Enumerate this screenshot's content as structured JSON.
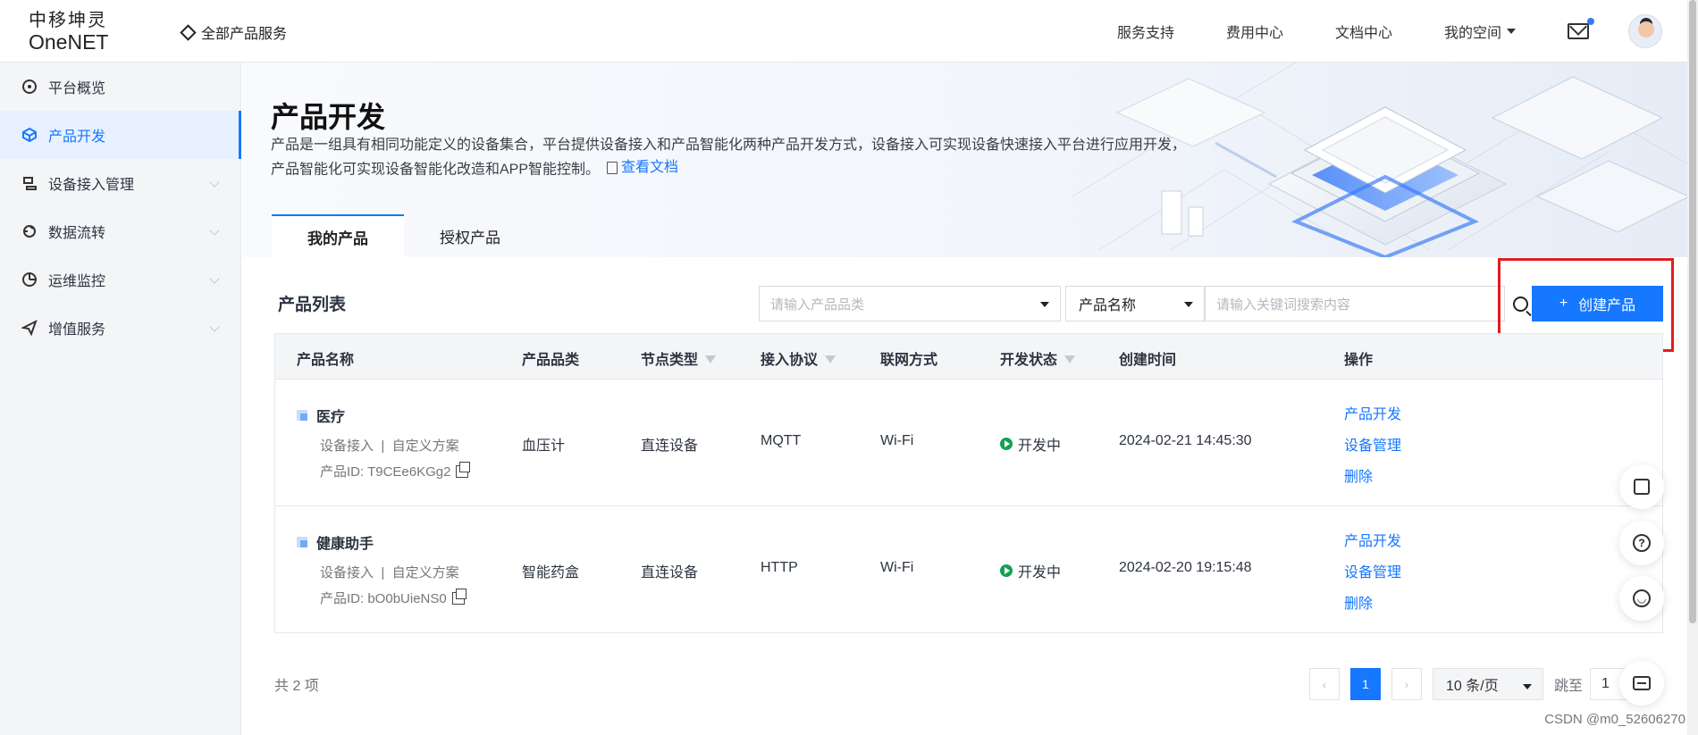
{
  "brand": {
    "line1": "中移坤灵",
    "line2": "OneNET"
  },
  "header": {
    "all_products": "全部产品服务",
    "links": [
      "服务支持",
      "费用中心",
      "文档中心"
    ],
    "my_space": "我的空间"
  },
  "sidebar": {
    "items": [
      {
        "label": "平台概览",
        "icon": "overview-icon"
      },
      {
        "label": "产品开发",
        "icon": "cube-icon"
      },
      {
        "label": "设备接入管理",
        "icon": "device-icon"
      },
      {
        "label": "数据流转",
        "icon": "data-flow-icon"
      },
      {
        "label": "运维监控",
        "icon": "monitor-icon"
      },
      {
        "label": "增值服务",
        "icon": "send-icon"
      }
    ]
  },
  "page": {
    "title": "产品开发",
    "description_line1": "产品是一组具有相同功能定义的设备集合，平台提供设备接入和产品智能化两种产品开发方式，设备接入可实现设备快速接入平台进行应用开发，",
    "description_line2": "产品智能化可实现设备智能化改造和APP智能控制。",
    "doc_link": "查看文档",
    "tabs": [
      "我的产品",
      "授权产品"
    ]
  },
  "toolbar": {
    "section_title": "产品列表",
    "category_placeholder": "请输入产品品类",
    "search_field_label": "产品名称",
    "search_placeholder": "请输入关键词搜索内容",
    "create_button": "创建产品"
  },
  "table": {
    "columns": [
      "产品名称",
      "产品品类",
      "节点类型",
      "接入协议",
      "联网方式",
      "开发状态",
      "创建时间",
      "操作"
    ],
    "rows": [
      {
        "name": "医疗",
        "access": "设备接入",
        "plan": "自定义方案",
        "product_id_label": "产品ID:",
        "product_id": "T9CEe6KGg2",
        "category": "血压计",
        "node_type": "直连设备",
        "protocol": "MQTT",
        "network": "Wi-Fi",
        "status": "开发中",
        "created": "2024-02-21 14:45:30",
        "actions": [
          "产品开发",
          "设备管理",
          "删除"
        ]
      },
      {
        "name": "健康助手",
        "access": "设备接入",
        "plan": "自定义方案",
        "product_id_label": "产品ID:",
        "product_id": "bO0bUieNS0",
        "category": "智能药盒",
        "node_type": "直连设备",
        "protocol": "HTTP",
        "network": "Wi-Fi",
        "status": "开发中",
        "created": "2024-02-20 19:15:48",
        "actions": [
          "产品开发",
          "设备管理",
          "删除"
        ]
      }
    ]
  },
  "pagination": {
    "total": "共 2 项",
    "prev": "‹",
    "current": "1",
    "next": "›",
    "page_size": "10 条/页",
    "jump_label": "跳至",
    "jump_value": "1"
  },
  "watermark": "CSDN @m0_52606270",
  "colors": {
    "primary": "#1677ff",
    "highlight": "#e01d1d",
    "status_green": "#12a150"
  }
}
